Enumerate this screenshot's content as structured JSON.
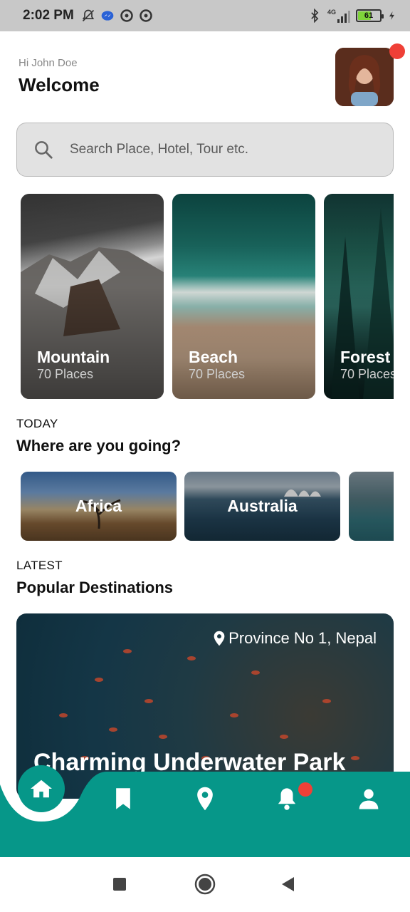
{
  "status_bar": {
    "time": "2:02 PM",
    "left_icons": [
      "muted-bell-icon",
      "messenger-icon",
      "vpn-icon",
      "vpn-icon"
    ],
    "right_icons": [
      "bluetooth-icon",
      "signal-4g-icon",
      "battery-icon",
      "charging-icon"
    ],
    "network": "4G",
    "battery_level": "61",
    "battery_fraction": 0.61
  },
  "header": {
    "greeting": "Hi John Doe",
    "title": "Welcome",
    "has_notification_dot": true
  },
  "search": {
    "placeholder": "Search Place, Hotel, Tour etc."
  },
  "categories": [
    {
      "title": "Mountain",
      "subtitle": "70 Places"
    },
    {
      "title": "Beach",
      "subtitle": "70 Places"
    },
    {
      "title": "Forest",
      "subtitle": "70 Places"
    }
  ],
  "today": {
    "label": "TODAY",
    "title": "Where are you going?",
    "destinations": [
      {
        "label": "Africa"
      },
      {
        "label": "Australia"
      },
      {
        "label": ""
      }
    ]
  },
  "latest": {
    "label": "LATEST",
    "title": "Popular Destinations",
    "card": {
      "location": "Province No 1, Nepal",
      "title": "Charming Underwater Park"
    }
  },
  "bottom_nav": {
    "items": [
      "home-icon",
      "bookmark-icon",
      "location-pin-icon",
      "bell-icon",
      "user-icon"
    ],
    "active": "home",
    "color": "#069789"
  },
  "system_nav": [
    "recents-button",
    "home-button",
    "back-button"
  ]
}
